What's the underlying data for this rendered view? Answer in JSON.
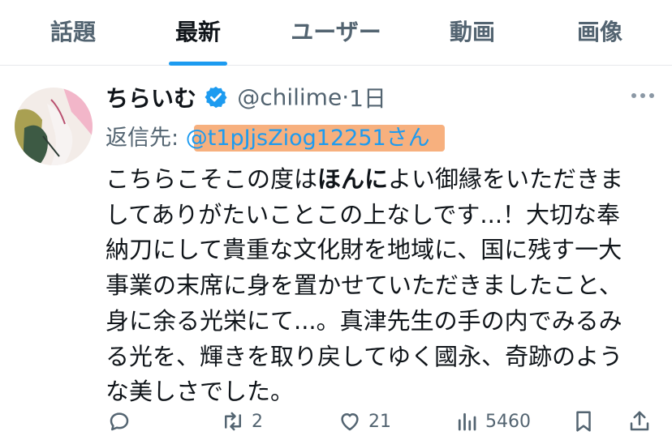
{
  "tabs": [
    {
      "label": "話題"
    },
    {
      "label": "最新"
    },
    {
      "label": "ユーザー"
    },
    {
      "label": "動画"
    },
    {
      "label": "画像"
    }
  ],
  "active_tab": "最新",
  "tweet": {
    "author_name": "ちらいむ",
    "author_handle": "@chilime",
    "time_separator": "·",
    "time": "1日",
    "reply_prefix": "返信先: ",
    "reply_to": "@t1pJjsZiog12251",
    "reply_suffix": "さん",
    "text_before_bold": "こちらこそこの度は",
    "text_bold": "ほんに",
    "text_after_bold": "よい御縁をいただきましてありがたいことこの上なしです...！大切な奉納刀にして貴重な文化財を地域に、国に残す一大事業の末席に身を置かせていただきましたこと、身に余る光栄にて...。真津先生の手の内でみるみる光を、輝きを取り戻してゆく國永、奇跡のような美しさでした。",
    "actions": {
      "retweets": "2",
      "likes": "21",
      "views": "5460"
    }
  },
  "colors": {
    "accent": "#1d9bf0",
    "highlight": "#f7b07e",
    "muted": "#536471"
  }
}
